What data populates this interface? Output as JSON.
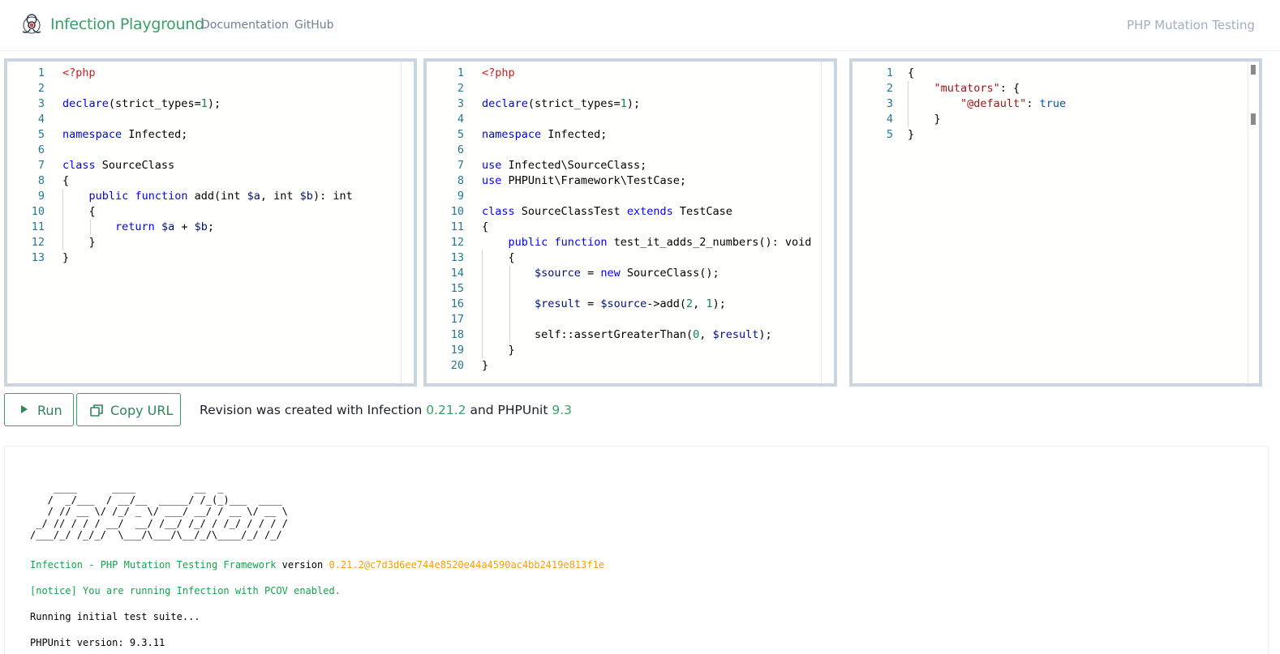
{
  "nav": {
    "brand": "Infection Playground",
    "links": [
      "Documentation",
      "GitHub"
    ],
    "tagline": "PHP Mutation Testing"
  },
  "editors": {
    "source": {
      "lines": [
        [
          [
            "<?php",
            "#c81e1e"
          ]
        ],
        [],
        [
          [
            "declare",
            "#0000ff"
          ],
          [
            "(strict_types=",
            "#000000"
          ],
          [
            "1",
            "#098658"
          ],
          [
            ");",
            "#000000"
          ]
        ],
        [],
        [
          [
            "namespace",
            "#0000ff"
          ],
          [
            " Infected;",
            "#000000"
          ]
        ],
        [],
        [
          [
            "class",
            "#0000ff"
          ],
          [
            " SourceClass",
            "#000000"
          ]
        ],
        [
          [
            "{",
            "#000000"
          ]
        ],
        [
          [
            "    ",
            "#000000"
          ],
          [
            "public",
            "#0000ff"
          ],
          [
            " ",
            "#000000"
          ],
          [
            "function",
            "#0000ff"
          ],
          [
            " add(int ",
            "#000000"
          ],
          [
            "$a",
            "#001080"
          ],
          [
            ", int ",
            "#000000"
          ],
          [
            "$b",
            "#001080"
          ],
          [
            "): int",
            "#000000"
          ]
        ],
        [
          [
            "    {",
            "#000000"
          ]
        ],
        [
          [
            "        ",
            "#000000"
          ],
          [
            "return",
            "#0000ff"
          ],
          [
            " ",
            "#000000"
          ],
          [
            "$a",
            "#001080"
          ],
          [
            " + ",
            "#000000"
          ],
          [
            "$b",
            "#001080"
          ],
          [
            ";",
            "#000000"
          ]
        ],
        [
          [
            "    }",
            "#000000"
          ]
        ],
        [
          [
            "}",
            "#000000"
          ]
        ]
      ]
    },
    "test": {
      "lines": [
        [
          [
            "<?php",
            "#c81e1e"
          ]
        ],
        [],
        [
          [
            "declare",
            "#0000ff"
          ],
          [
            "(strict_types=",
            "#000000"
          ],
          [
            "1",
            "#098658"
          ],
          [
            ");",
            "#000000"
          ]
        ],
        [],
        [
          [
            "namespace",
            "#0000ff"
          ],
          [
            " Infected;",
            "#000000"
          ]
        ],
        [],
        [
          [
            "use",
            "#0000ff"
          ],
          [
            " Infected\\SourceClass;",
            "#000000"
          ]
        ],
        [
          [
            "use",
            "#0000ff"
          ],
          [
            " PHPUnit\\Framework\\TestCase;",
            "#000000"
          ]
        ],
        [],
        [
          [
            "class",
            "#0000ff"
          ],
          [
            " SourceClassTest ",
            "#000000"
          ],
          [
            "extends",
            "#0000ff"
          ],
          [
            " TestCase",
            "#000000"
          ]
        ],
        [
          [
            "{",
            "#000000"
          ]
        ],
        [
          [
            "    ",
            "#000000"
          ],
          [
            "public",
            "#0000ff"
          ],
          [
            " ",
            "#000000"
          ],
          [
            "function",
            "#0000ff"
          ],
          [
            " test_it_adds_2_numbers(): void",
            "#000000"
          ]
        ],
        [
          [
            "    {",
            "#000000"
          ]
        ],
        [
          [
            "        ",
            "#000000"
          ],
          [
            "$source",
            "#001080"
          ],
          [
            " = ",
            "#000000"
          ],
          [
            "new",
            "#0000ff"
          ],
          [
            " SourceClass();",
            "#000000"
          ]
        ],
        [],
        [
          [
            "        ",
            "#000000"
          ],
          [
            "$result",
            "#001080"
          ],
          [
            " = ",
            "#000000"
          ],
          [
            "$source",
            "#001080"
          ],
          [
            "->add(",
            "#000000"
          ],
          [
            "2",
            "#098658"
          ],
          [
            ", ",
            "#000000"
          ],
          [
            "1",
            "#098658"
          ],
          [
            ");",
            "#000000"
          ]
        ],
        [],
        [
          [
            "        self::assertGreaterThan(",
            "#000000"
          ],
          [
            "0",
            "#098658"
          ],
          [
            ", ",
            "#000000"
          ],
          [
            "$result",
            "#001080"
          ],
          [
            ");",
            "#000000"
          ]
        ],
        [
          [
            "    }",
            "#000000"
          ]
        ],
        [
          [
            "}",
            "#000000"
          ]
        ]
      ]
    },
    "config": {
      "lines": [
        [
          [
            "{",
            "#000000"
          ]
        ],
        [
          [
            "    ",
            "#000000"
          ],
          [
            "\"mutators\"",
            "#a31515"
          ],
          [
            ": {",
            "#000000"
          ]
        ],
        [
          [
            "        ",
            "#000000"
          ],
          [
            "\"@default\"",
            "#a31515"
          ],
          [
            ": ",
            "#000000"
          ],
          [
            "true",
            "#0451a5"
          ]
        ],
        [
          [
            "    }",
            "#000000"
          ]
        ],
        [
          [
            "}",
            "#000000"
          ]
        ]
      ]
    }
  },
  "actions": {
    "run_label": "Run",
    "copy_label": "Copy URL",
    "revision_prefix": "Revision was created with Infection",
    "infection_version": "0.21.2",
    "revision_and": "and PHPUnit",
    "phpunit_version": "9.3"
  },
  "output": {
    "ascii_art": "    ____      ____          __  _\n   /  _/___  / __/__  _____/ /_(_)___  ____\n   / // __ \\/ /_/ _ \\/ ___/ __/ / __ \\/ __ \\\n _/ // / / / __/  __/ /__/ /_/ / /_/ / / / /\n/___/_/ /_/_/  \\___/\\___/\\__/_/\\____/_/ /_/",
    "framework_text": "Infection - PHP Mutation Testing Framework",
    "version_word": "version",
    "version_hash": "0.21.2@c7d3d6ee744e8520e44a4590ac4bb2419e813f1e",
    "notice": "[notice] You are running Infection with PCOV enabled.",
    "running": "Running initial test suite...",
    "phpunit": "PHPUnit version: 9.3.11"
  }
}
